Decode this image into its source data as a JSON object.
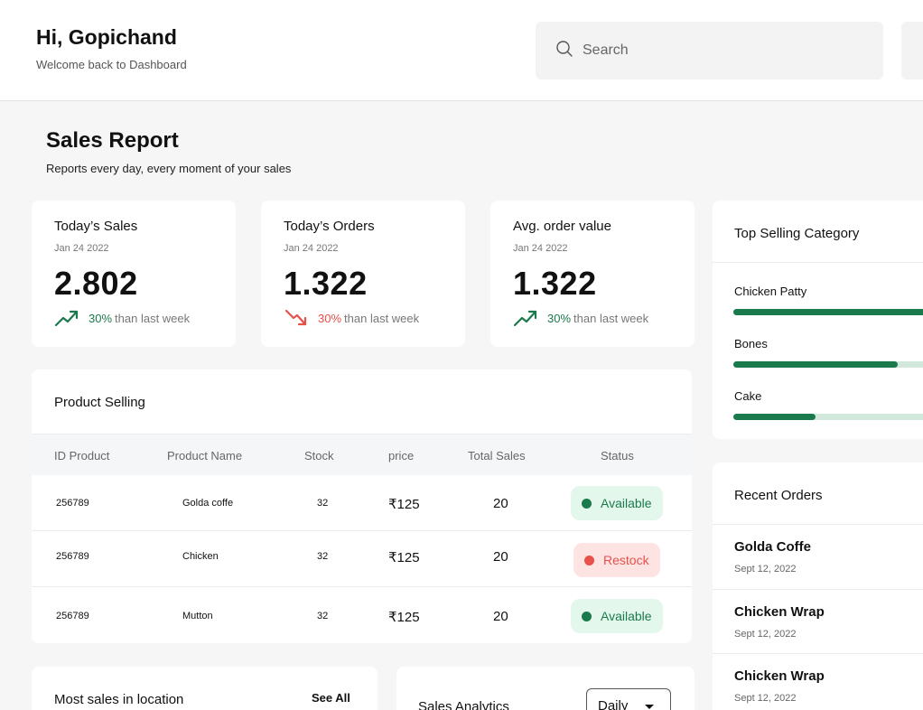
{
  "header": {
    "greeting": "Hi, Gopichand",
    "subtitle": "Welcome back to Dashboard",
    "search_placeholder": "Search"
  },
  "report": {
    "title": "Sales Report",
    "subtitle": "Reports every day, every moment of your sales"
  },
  "stats": [
    {
      "label": "Today’s Sales",
      "date": "Jan 24 2022",
      "value": "2.802",
      "pct": "30%",
      "suffix": "than last week",
      "trend": "up"
    },
    {
      "label": "Today’s Orders",
      "date": "Jan 24 2022",
      "value": "1.322",
      "pct": "30%",
      "suffix": "than last week",
      "trend": "down"
    },
    {
      "label": "Avg. order value",
      "date": "Jan 24 2022",
      "value": "1.322",
      "pct": "30%",
      "suffix": "than last week",
      "trend": "up"
    }
  ],
  "product_table": {
    "title": "Product Selling",
    "columns": [
      "ID Product",
      "Product Name",
      "Stock",
      "price",
      "Total Sales",
      "Status"
    ],
    "rows": [
      {
        "id": "256789",
        "name": "Golda coffe",
        "stock": "32",
        "price": "₹125",
        "sales": "20",
        "status": "Available"
      },
      {
        "id": "256789",
        "name": "Chicken",
        "stock": "32",
        "price": "₹125",
        "sales": "20",
        "status": "Restock"
      },
      {
        "id": "256789",
        "name": "Mutton",
        "stock": "32",
        "price": "₹125",
        "sales": "20",
        "status": "Available"
      }
    ]
  },
  "top_category": {
    "title": "Top Selling Category",
    "items": [
      {
        "name": "Chicken Patty",
        "fill": 1.0
      },
      {
        "name": "Bones",
        "fill": 0.76
      },
      {
        "name": "Cake",
        "fill": 0.38
      }
    ]
  },
  "recent_orders": {
    "title": "Recent Orders",
    "items": [
      {
        "name": "Golda Coffe",
        "date": "Sept 12, 2022"
      },
      {
        "name": "Chicken Wrap",
        "date": "Sept 12, 2022"
      },
      {
        "name": "Chicken Wrap",
        "date": "Sept 12, 2022"
      }
    ]
  },
  "location": {
    "title": "Most sales in location",
    "see_all": "See All"
  },
  "analytics": {
    "title": "Sales Analytics",
    "selected": "Daily"
  },
  "colors": {
    "accent_green": "#1b7a4c",
    "accent_red": "#e8504a",
    "page_bg": "#f6f6f6"
  }
}
